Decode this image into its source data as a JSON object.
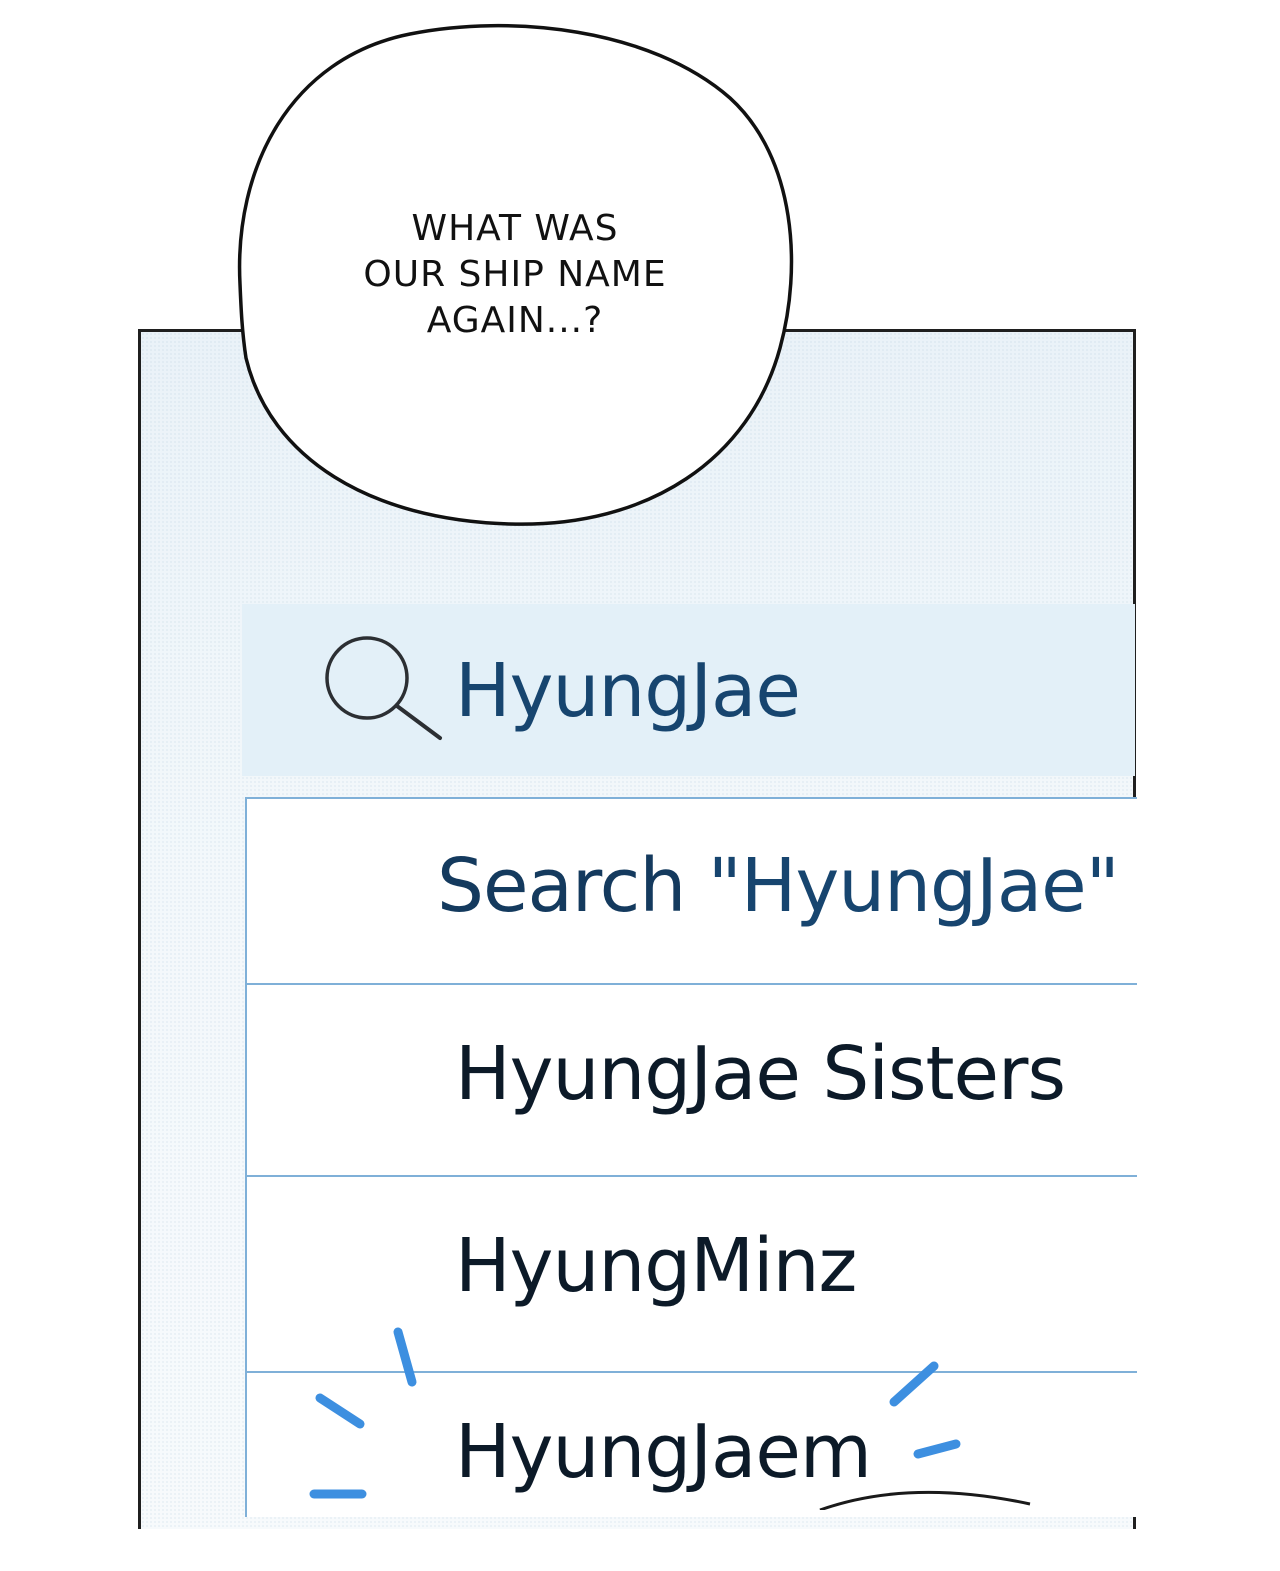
{
  "speech_bubble": {
    "lines": [
      "WHAT WAS",
      "OUR SHIP NAME",
      "AGAIN...?"
    ]
  },
  "search": {
    "query": "HyungJae",
    "icon": "search-icon"
  },
  "results": {
    "suggestion_prefix": "Search ",
    "suggestion_query": "\"HyungJae\"",
    "items": [
      "HyungJae Sisters",
      "HyungMinz",
      "HyungJaem"
    ]
  },
  "colors": {
    "accent": "#17456f",
    "divider": "#7fb0d8",
    "search_bar_bg": "#e3f0f8",
    "emphasis_strokes": "#3d8fe0"
  }
}
